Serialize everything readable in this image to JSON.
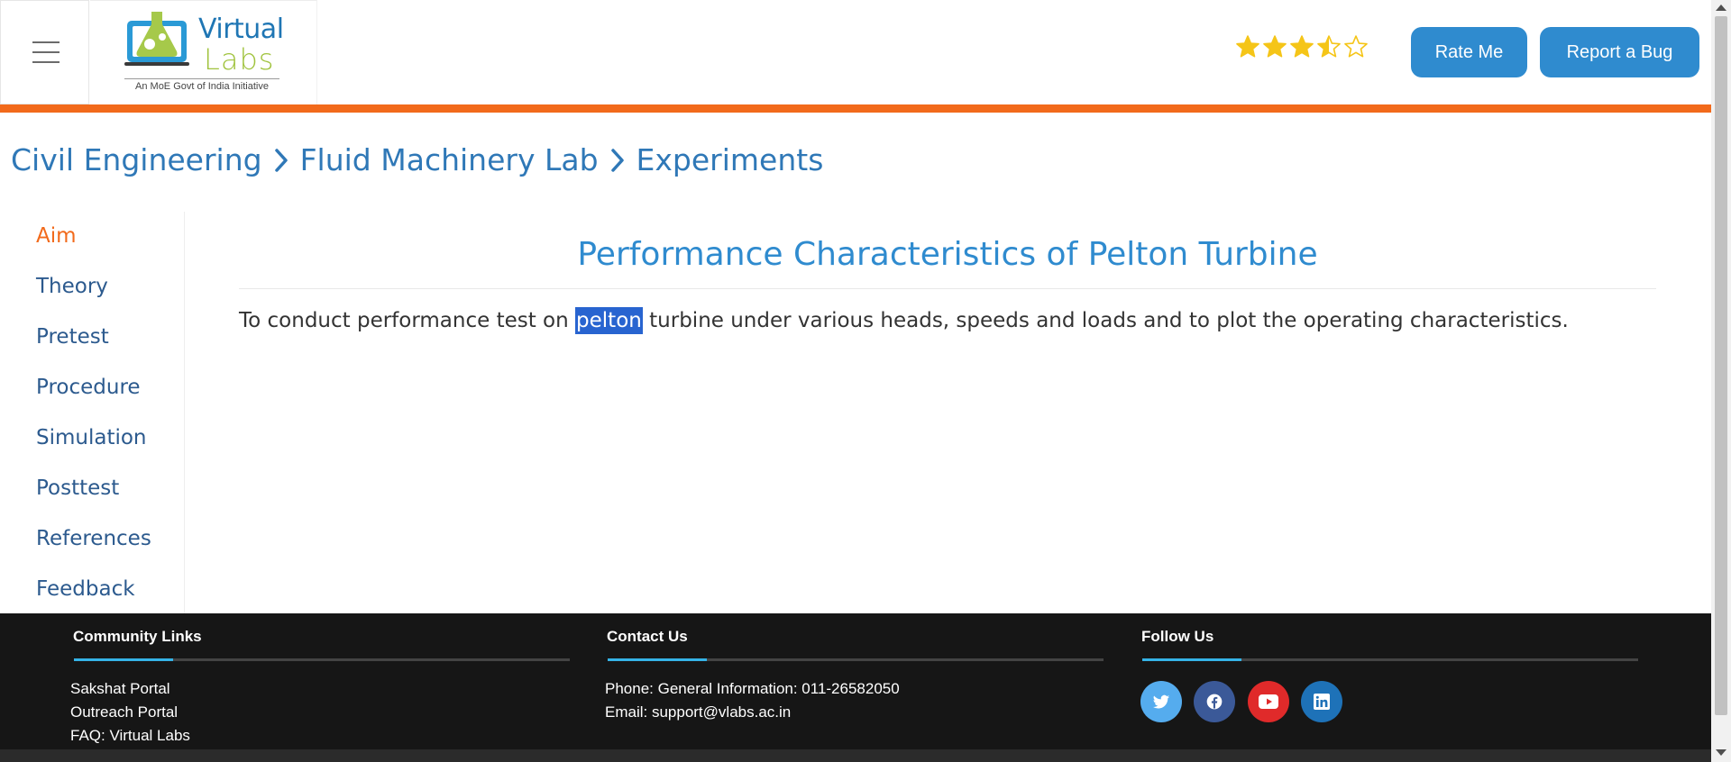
{
  "header": {
    "logo_word1": "Virtual",
    "logo_word2": "Labs",
    "logo_tagline": "An MoE Govt of India Initiative",
    "rating": 3.5,
    "rating_max": 5,
    "rate_label": "Rate Me",
    "bug_label": "Report a Bug"
  },
  "breadcrumb": {
    "items": [
      "Civil Engineering",
      "Fluid Machinery Lab",
      "Experiments"
    ]
  },
  "sidebar": {
    "items": [
      {
        "label": "Aim",
        "active": true
      },
      {
        "label": "Theory"
      },
      {
        "label": "Pretest"
      },
      {
        "label": "Procedure"
      },
      {
        "label": "Simulation"
      },
      {
        "label": "Posttest"
      },
      {
        "label": "References"
      },
      {
        "label": "Feedback"
      }
    ]
  },
  "main": {
    "title": "Performance Characteristics of Pelton Turbine",
    "aim_before": "To conduct performance test on ",
    "aim_selected": "pelton",
    "aim_after": " turbine under various heads, speeds and loads and to plot the operating characteristics."
  },
  "footer": {
    "community": {
      "heading": "Community Links",
      "links": [
        "Sakshat Portal",
        "Outreach Portal",
        "FAQ: Virtual Labs"
      ]
    },
    "contact": {
      "heading": "Contact Us",
      "phone": "Phone: General Information: 011-26582050",
      "email": "Email: support@vlabs.ac.in"
    },
    "follow": {
      "heading": "Follow Us",
      "icons": [
        "twitter-icon",
        "facebook-icon",
        "youtube-icon",
        "linkedin-icon"
      ]
    }
  },
  "colors": {
    "accent_orange": "#f26a1b",
    "link_blue": "#2f78b7",
    "button_blue": "#2f8bcf",
    "star_gold": "#f5c518",
    "twitter": "#55acee",
    "facebook": "#3b5998",
    "youtube": "#e02a2a",
    "linkedin": "#1e72b8"
  }
}
